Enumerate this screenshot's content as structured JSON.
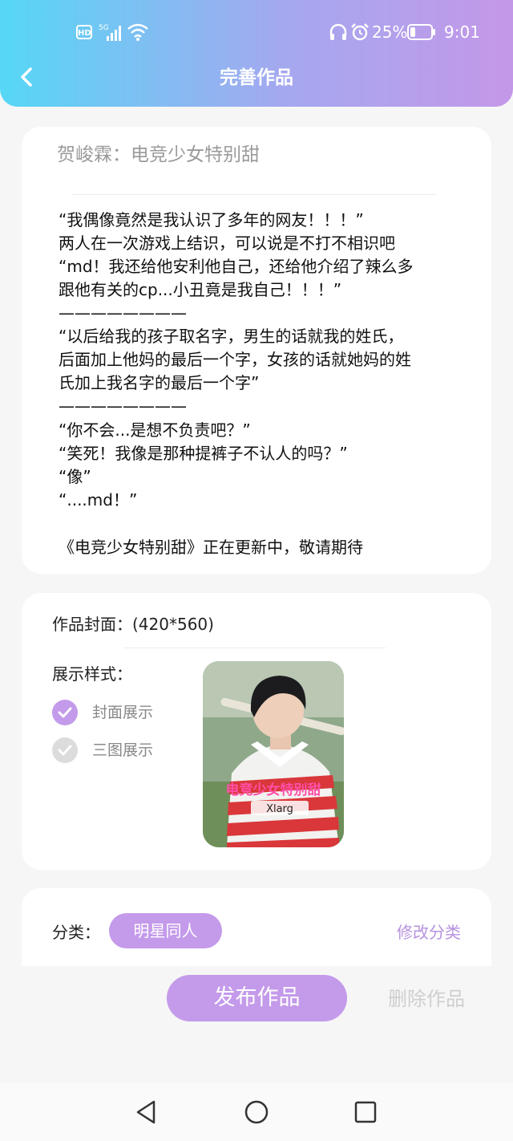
{
  "status_bar": {
    "hd": "HD",
    "network": "5G",
    "battery_pct": "25%",
    "time": "9:01",
    "battery_level": 0.25
  },
  "header": {
    "title": "完善作品"
  },
  "story": {
    "title": "贺峻霖：电竞少女特别甜",
    "lines": [
      "“我偶像竟然是我认识了多年的网友！！！”",
      "两人在一次游戏上结识，可以说是不打不相识吧",
      "“md！我还给他安利他自己，还给他介绍了辣么多",
      "跟他有关的cp...小丑竟是我自己！！！”",
      "————————",
      "“以后给我的孩子取名字，男生的话就我的姓氏，",
      "后面加上他妈的最后一个字，女孩的话就她妈的姓",
      "氏加上我名字的最后一个字”",
      "————————",
      "“你不会...是想不负责吧？”",
      "“笑死！我像是那种提裤子不认人的吗？”",
      "“像”",
      "“....md！”",
      "",
      "《电竞少女特别甜》正在更新中，敬请期待"
    ]
  },
  "cover_section": {
    "label": "作品封面：(420*560)",
    "style_label": "展示样式：",
    "options": [
      {
        "label": "封面展示",
        "checked": true
      },
      {
        "label": "三图展示",
        "checked": false
      }
    ],
    "overlay_text": "电竞少女特别甜"
  },
  "category": {
    "label": "分类：",
    "value": "明星同人",
    "edit": "修改分类"
  },
  "actions": {
    "publish": "发布作品",
    "delete": "删除作品"
  },
  "colors": {
    "accent": "#c49aea",
    "header_start": "#56d7f6",
    "header_end": "#c498e8",
    "unchecked": "#dcdcdc"
  }
}
